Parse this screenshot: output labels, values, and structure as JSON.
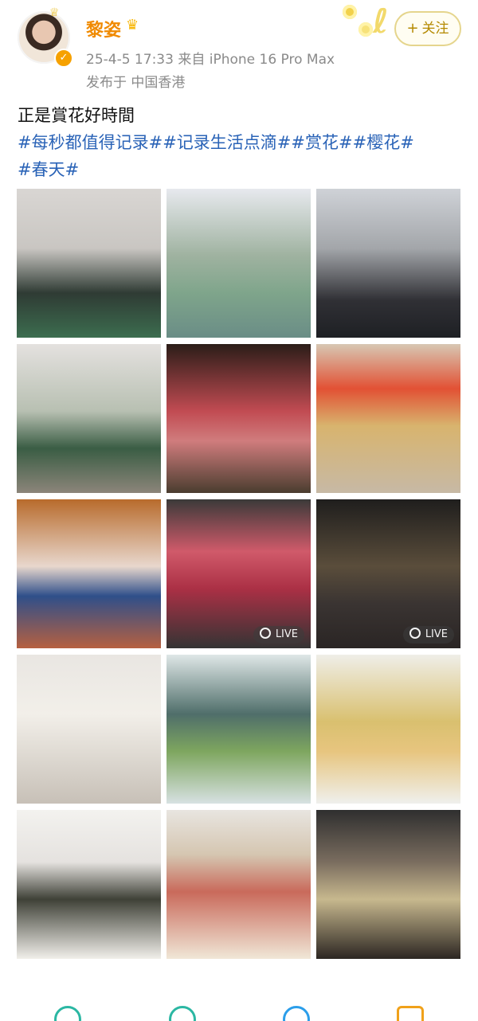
{
  "header": {
    "username": "黎姿",
    "meta_line": "25-4-5 17:33  来自 iPhone 16 Pro Max",
    "posted_location": "发布于 中国香港",
    "follow_button": {
      "plus": "+",
      "label": "关注"
    }
  },
  "post": {
    "text": "正是賞花好時間",
    "hashtags": [
      "#每秒都值得记录#",
      "#记录生活点滴#",
      "#赏花#",
      "#樱花#",
      "#春天#"
    ]
  },
  "grid": {
    "tiles": [
      {
        "name": "cherry-blossom-photo-1"
      },
      {
        "name": "cherry-blossom-photo-2"
      },
      {
        "name": "cherry-blossom-photo-3"
      },
      {
        "name": "cherry-blossom-photo-4"
      },
      {
        "name": "wagyu-platter-photo"
      },
      {
        "name": "sushi-plates-photo"
      },
      {
        "name": "appetizers-collage-photo"
      },
      {
        "name": "grilled-wagyu-photo",
        "badge": "LIVE"
      },
      {
        "name": "bar-interior-photo",
        "badge": "LIVE"
      },
      {
        "name": "tomato-bites-photo"
      },
      {
        "name": "fish-vegetables-photo"
      },
      {
        "name": "shrimp-dish-photo"
      },
      {
        "name": "grilled-fish-photo"
      },
      {
        "name": "fish-fillet-dish-photo"
      },
      {
        "name": "toast-drinks-photo"
      }
    ]
  },
  "icons": {
    "verified": "verified-badge-icon",
    "crown": "crown-icon",
    "vip": "vip-icon",
    "live": "live-icon"
  },
  "colors": {
    "username": "#f08a00",
    "hashtags": "#2a63b7",
    "meta": "#8a8a8a",
    "follow_border": "#e5d58d",
    "follow_text": "#b48900"
  }
}
